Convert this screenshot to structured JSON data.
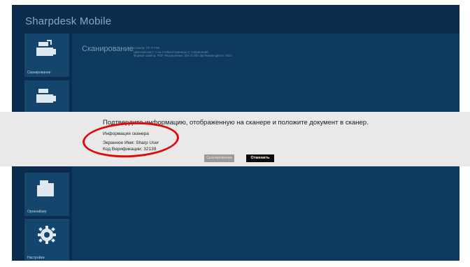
{
  "app": {
    "title": "Sharpdesk Mobile"
  },
  "sidebar": {
    "items": [
      {
        "label": "Сканирование",
        "icon": "scanner-icon"
      },
      {
        "label": "",
        "icon": "scanner-icon"
      },
      {
        "label": "",
        "icon": "scan-progress-icon"
      },
      {
        "label": "Органайзер",
        "icon": "folder-icon"
      },
      {
        "label": "Настройки",
        "icon": "gear-icon"
      }
    ]
  },
  "panel": {
    "title": "Сканирование",
    "details": [
      "Сканер: SF-X F96",
      "Цветной лист: 1 на стойке/страницы 1: сохранений",
      "Формат файла: PDF  Разрешение: 200 X 200 dpi  Режим цвета: Авто"
    ]
  },
  "dialog": {
    "message": "Подтвердите информацию, отображенную на сканере и положите документ в сканер.",
    "info_heading": "Информация сканера",
    "screen_name": "Экранное Имя: Sharp User",
    "verification_code": "Код Верификации: 32139",
    "scan_button": "Сканирование",
    "cancel_button": "Отменить"
  },
  "colors": {
    "background": "#0b2c4c",
    "panel": "#0f3a5f",
    "tile": "#14456c",
    "dialog": "#e9e9e9",
    "annotation": "#e00a0a"
  }
}
